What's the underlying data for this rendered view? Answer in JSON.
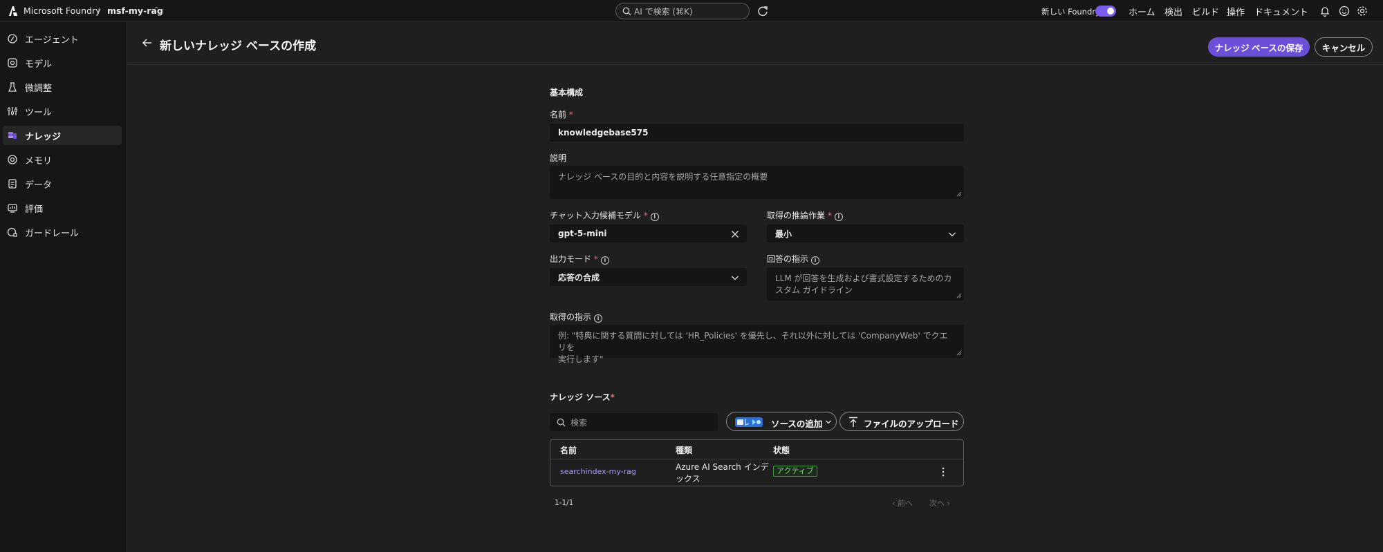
{
  "topbar": {
    "brand": "Microsoft Foundry",
    "separator": "/",
    "project": "msf-my-rag",
    "search_placeholder": "AI で検索 (⌘K)",
    "new_foundry_label": "新しい Foundry",
    "nav": [
      "ホーム",
      "検出",
      "ビルド",
      "操作",
      "ドキュメント"
    ]
  },
  "sidebar": {
    "items": [
      {
        "label": "エージェント",
        "icon": "agent-icon"
      },
      {
        "label": "モデル",
        "icon": "model-icon"
      },
      {
        "label": "微調整",
        "icon": "flask-icon"
      },
      {
        "label": "ツール",
        "icon": "tools-icon"
      },
      {
        "label": "ナレッジ",
        "icon": "knowledge-icon",
        "active": true
      },
      {
        "label": "メモリ",
        "icon": "memory-icon"
      },
      {
        "label": "データ",
        "icon": "data-icon"
      },
      {
        "label": "評価",
        "icon": "evaluation-icon"
      },
      {
        "label": "ガードレール",
        "icon": "guardrail-icon"
      }
    ]
  },
  "header": {
    "title": "新しいナレッジ ベースの作成",
    "save_label": "ナレッジ ベースの保存",
    "cancel_label": "キャンセル"
  },
  "form": {
    "section_title": "基本構成",
    "name_label": "名前",
    "required_mark": "*",
    "name_value": "knowledgebase575",
    "description_label": "説明",
    "description_placeholder": "ナレッジ ベースの目的と内容を説明する任意指定の概要",
    "chat_model_label": "チャット入力候補モデル",
    "chat_model_value": "gpt-5-mini",
    "reasoning_label": "取得の推論作業",
    "reasoning_value": "最小",
    "output_mode_label": "出力モード",
    "output_mode_value": "応答の合成",
    "answer_instructions_label": "回答の指示",
    "answer_instructions_placeholder_line1": "LLM が回答を生成および書式設定するためのカ",
    "answer_instructions_placeholder_line2": "スタム ガイドライン",
    "retrieval_instructions_label": "取得の指示",
    "retrieval_instructions_placeholder_line1": "例: \"特典に関する質問に対しては 'HR_Policies' を優先し、それ以外に対しては 'CompanyWeb' でクエリを",
    "retrieval_instructions_placeholder_line2": "実行します\""
  },
  "sources": {
    "title": "ナレッジ ソース",
    "search_placeholder": "検索",
    "add_source_label": "ソースの追加",
    "upload_label": "ファイルのアップロード",
    "columns": [
      "名前",
      "種類",
      "状態"
    ],
    "rows": [
      {
        "name": "searchindex-my-rag",
        "type_line1": "Azure AI Search インデ",
        "type_line2": "ックス",
        "status": "アクティブ"
      }
    ],
    "pager_count": "1-1/1",
    "prev_label": "前へ",
    "next_label": "次へ"
  },
  "colors": {
    "accent": "#6b4fd8",
    "toggle": "#7a5cf0",
    "link": "#a99bf5",
    "status_active": "#7fd47f",
    "required": "#e06c75"
  }
}
